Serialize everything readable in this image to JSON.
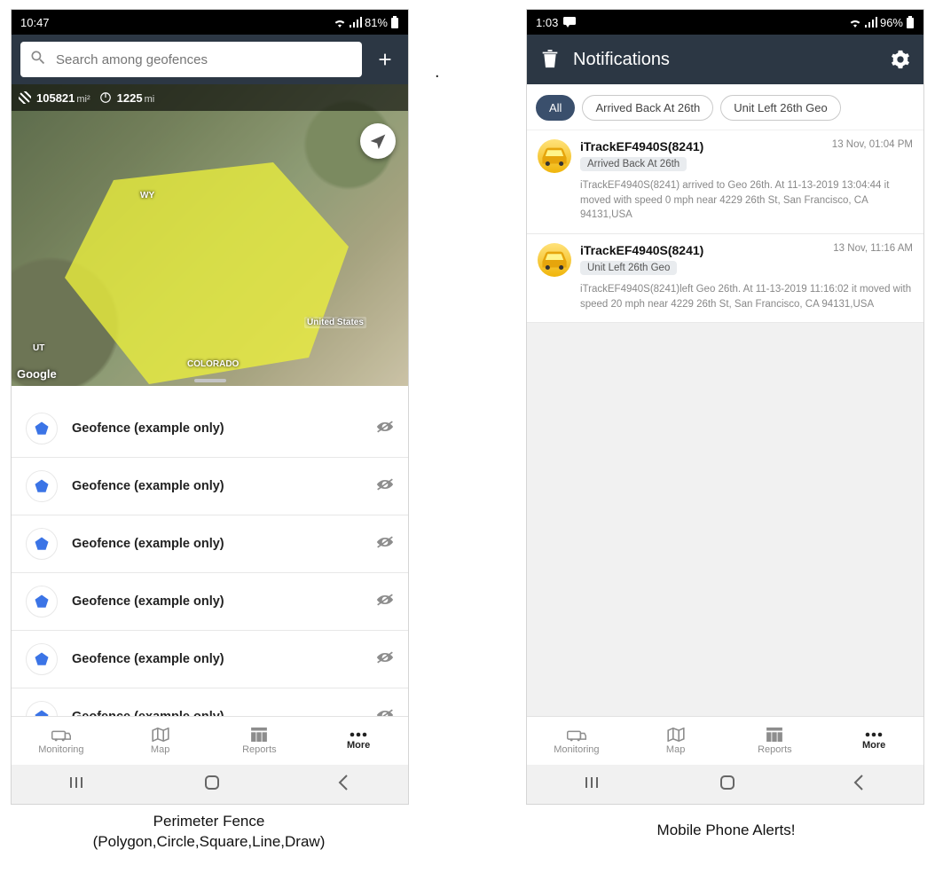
{
  "left": {
    "status": {
      "time": "10:47",
      "battery": "81%"
    },
    "search": {
      "placeholder": "Search among geofences"
    },
    "map_info": {
      "area": "105821",
      "area_unit": "mi²",
      "perimeter": "1225",
      "perimeter_unit": "mi"
    },
    "map_labels": {
      "wy": "WY",
      "ut": "UT",
      "co": "COLORADO",
      "us": "United States"
    },
    "attribution": "Google",
    "geofences": [
      {
        "name": "Geofence (example only)"
      },
      {
        "name": "Geofence (example only)"
      },
      {
        "name": "Geofence (example only)"
      },
      {
        "name": "Geofence (example only)"
      },
      {
        "name": "Geofence (example only)"
      },
      {
        "name": "Geofence (example only)"
      }
    ],
    "tabs": {
      "monitoring": "Monitoring",
      "map": "Map",
      "reports": "Reports",
      "more": "More"
    },
    "caption": "Perimeter Fence\n(Polygon,Circle,Square,Line,Draw)"
  },
  "right": {
    "status": {
      "time": "1:03",
      "battery": "96%"
    },
    "title": "Notifications",
    "filters": {
      "all": "All",
      "f1": "Arrived Back At 26th",
      "f2": "Unit Left 26th Geo"
    },
    "notifications": [
      {
        "unit": "iTrackEF4940S(8241)",
        "time": "13 Nov, 01:04 PM",
        "tag": "Arrived Back At 26th",
        "body": "iTrackEF4940S(8241) arrived to Geo 26th.     At 11-13-2019 13:04:44 it moved with speed 0 mph near 4229 26th St, San Francisco, CA 94131,USA"
      },
      {
        "unit": "iTrackEF4940S(8241)",
        "time": "13 Nov, 11:16 AM",
        "tag": "Unit Left 26th Geo",
        "body": "iTrackEF4940S(8241)left Geo 26th.     At 11-13-2019 11:16:02 it moved with speed 20 mph near 4229 26th St, San Francisco, CA 94131,USA"
      }
    ],
    "tabs": {
      "monitoring": "Monitoring",
      "map": "Map",
      "reports": "Reports",
      "more": "More"
    },
    "caption": "Mobile Phone Alerts!"
  }
}
